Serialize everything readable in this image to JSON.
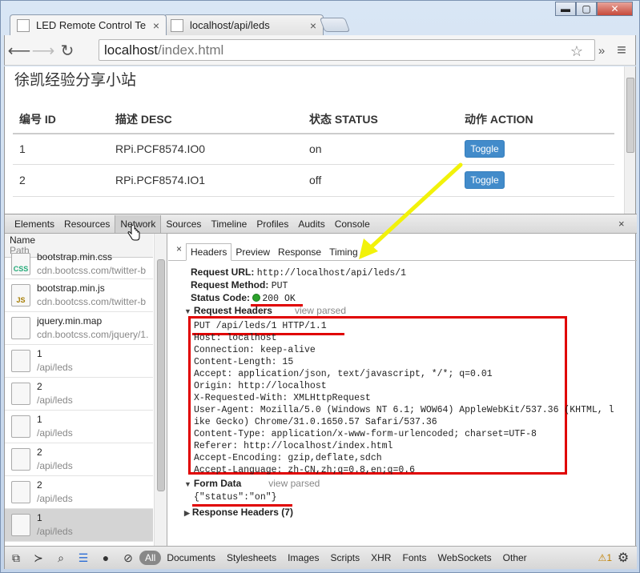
{
  "browser": {
    "tabs": [
      {
        "title": "LED Remote Control Te",
        "close": "×"
      },
      {
        "title": "localhost/api/leds",
        "close": "×"
      }
    ],
    "window_controls": {
      "minimize": "▬",
      "maximize": "▢",
      "close": "✕"
    },
    "url": {
      "host": "localhost",
      "path": "/index.html"
    },
    "more": "»",
    "menu": "≡"
  },
  "page": {
    "title": "徐凯经验分享小站",
    "columns": [
      "编号 ID",
      "描述 DESC",
      "状态 STATUS",
      "动作 ACTION"
    ],
    "rows": [
      {
        "id": "1",
        "desc": "RPi.PCF8574.IO0",
        "status": "on",
        "action": "Toggle"
      },
      {
        "id": "2",
        "desc": "RPi.PCF8574.IO1",
        "status": "off",
        "action": "Toggle"
      }
    ]
  },
  "devtools": {
    "tabs": [
      "Elements",
      "Resources",
      "Network",
      "Sources",
      "Timeline",
      "Profiles",
      "Audits",
      "Console"
    ],
    "selected_tab": "Network",
    "close": "×",
    "list_header": {
      "name": "Name",
      "path": "Path"
    },
    "requests": [
      {
        "name": "bootstrap.min.css",
        "path": "cdn.bootcss.com/twitter-b",
        "icon": "CSS"
      },
      {
        "name": "bootstrap.min.js",
        "path": "cdn.bootcss.com/twitter-b",
        "icon": "JS"
      },
      {
        "name": "jquery.min.map",
        "path": "cdn.bootcss.com/jquery/1.",
        "icon": ""
      },
      {
        "name": "1",
        "path": "/api/leds",
        "icon": ""
      },
      {
        "name": "2",
        "path": "/api/leds",
        "icon": ""
      },
      {
        "name": "1",
        "path": "/api/leds",
        "icon": ""
      },
      {
        "name": "2",
        "path": "/api/leds",
        "icon": ""
      },
      {
        "name": "2",
        "path": "/api/leds",
        "icon": ""
      },
      {
        "name": "1",
        "path": "/api/leds",
        "icon": ""
      }
    ],
    "detail_tabs": [
      "Headers",
      "Preview",
      "Response",
      "Timing"
    ],
    "detail_close": "×",
    "general": {
      "url_label": "Request URL:",
      "url": "http://localhost/api/leds/1",
      "method_label": "Request Method:",
      "method": "PUT",
      "status_label": "Status Code:",
      "status": "200 OK"
    },
    "request_headers_title": "Request Headers",
    "view_parsed": "view parsed",
    "request_headers": [
      "PUT /api/leds/1 HTTP/1.1",
      "Host: localhost",
      "Connection: keep-alive",
      "Content-Length: 15",
      "Accept: application/json, text/javascript, */*; q=0.01",
      "Origin: http://localhost",
      "X-Requested-With: XMLHttpRequest",
      "User-Agent: Mozilla/5.0 (Windows NT 6.1; WOW64) AppleWebKit/537.36 (KHTML, l",
      "ike Gecko) Chrome/31.0.1650.57 Safari/537.36",
      "Content-Type: application/x-www-form-urlencoded; charset=UTF-8",
      "Referer: http://localhost/index.html",
      "Accept-Encoding: gzip,deflate,sdch",
      "Accept-Language: zh-CN,zh;q=0.8,en;q=0.6"
    ],
    "form_data_title": "Form Data",
    "form_data": "{\"status\":\"on\"}",
    "response_headers_title": "Response Headers (7)",
    "filters": [
      "All",
      "Documents",
      "Stylesheets",
      "Images",
      "Scripts",
      "XHR",
      "Fonts",
      "WebSockets",
      "Other"
    ],
    "selected_filter": "All",
    "warning_count": "1"
  },
  "colors": {
    "accent_button": "#428bca",
    "annotation_red": "#e00000",
    "annotation_arrow": "#f2f20a"
  }
}
